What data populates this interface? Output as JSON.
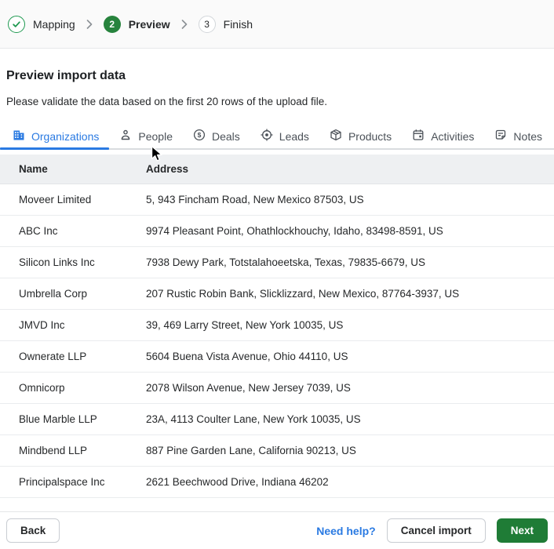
{
  "colors": {
    "accent_blue": "#2a7ae2",
    "step_green": "#27833d",
    "check_green": "#1e9950",
    "button_green": "#1f7c36",
    "table_header_bg": "#eef0f2"
  },
  "stepper": {
    "steps": [
      {
        "label": "Mapping",
        "state": "done"
      },
      {
        "label": "Preview",
        "number": "2",
        "state": "active"
      },
      {
        "label": "Finish",
        "number": "3",
        "state": "upcoming"
      }
    ]
  },
  "header": {
    "title": "Preview import data",
    "subtitle": "Please validate the data based on the first 20 rows of the upload file."
  },
  "tabs": [
    {
      "label": "Organizations",
      "icon": "buildings-icon",
      "active": true
    },
    {
      "label": "People",
      "icon": "person-icon",
      "active": false
    },
    {
      "label": "Deals",
      "icon": "dollar-circle-icon",
      "active": false
    },
    {
      "label": "Leads",
      "icon": "target-icon",
      "active": false
    },
    {
      "label": "Products",
      "icon": "package-icon",
      "active": false
    },
    {
      "label": "Activities",
      "icon": "calendar-icon",
      "active": false
    },
    {
      "label": "Notes",
      "icon": "note-icon",
      "active": false
    }
  ],
  "table": {
    "columns": [
      "Name",
      "Address"
    ],
    "rows": [
      [
        "Moveer Limited",
        "5, 943 Fincham Road, New Mexico 87503, US"
      ],
      [
        "ABC Inc",
        "9974 Pleasant Point, Ohathlockhouchy, Idaho, 83498-8591, US"
      ],
      [
        "Silicon Links Inc",
        "7938 Dewy Park, Totstalahoeetska, Texas, 79835-6679, US"
      ],
      [
        "Umbrella Corp",
        "207 Rustic Robin Bank, Slicklizzard, New Mexico, 87764-3937, US"
      ],
      [
        "JMVD Inc",
        "39, 469 Larry Street, New York 10035, US"
      ],
      [
        "Ownerate LLP",
        "5604 Buena Vista Avenue, Ohio 44110, US"
      ],
      [
        "Omnicorp",
        "2078 Wilson Avenue, New Jersey 7039, US"
      ],
      [
        "Blue Marble LLP",
        "23A, 4113 Coulter Lane, New York 10035, US"
      ],
      [
        "Mindbend LLP",
        "887 Pine Garden Lane, California 90213, US"
      ],
      [
        "Principalspace Inc",
        "2621 Beechwood Drive, Indiana 46202"
      ]
    ]
  },
  "footer": {
    "back_label": "Back",
    "help_label": "Need help?",
    "cancel_label": "Cancel import",
    "next_label": "Next"
  }
}
